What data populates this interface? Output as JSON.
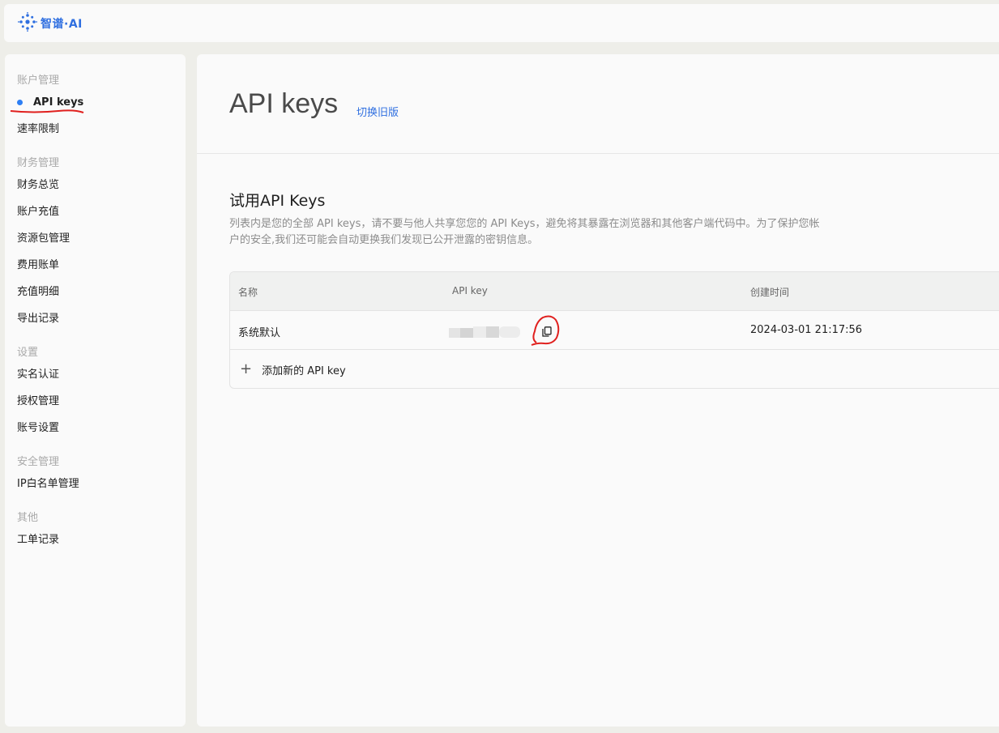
{
  "brand": {
    "name": "智谱·AI",
    "icon": "logo-dots-icon",
    "color": "#2f6fe0"
  },
  "sidebar": {
    "groups": [
      {
        "title": "账户管理",
        "items": [
          {
            "label": "API keys",
            "active": true
          },
          {
            "label": "速率限制"
          }
        ]
      },
      {
        "title": "财务管理",
        "items": [
          {
            "label": "财务总览"
          },
          {
            "label": "账户充值"
          },
          {
            "label": "资源包管理"
          },
          {
            "label": "费用账单"
          },
          {
            "label": "充值明细"
          },
          {
            "label": "导出记录"
          }
        ]
      },
      {
        "title": "设置",
        "items": [
          {
            "label": "实名认证"
          },
          {
            "label": "授权管理"
          },
          {
            "label": "账号设置"
          }
        ]
      },
      {
        "title": "安全管理",
        "items": [
          {
            "label": "IP白名单管理"
          }
        ]
      },
      {
        "title": "其他",
        "items": [
          {
            "label": "工单记录"
          }
        ]
      }
    ]
  },
  "main": {
    "title": "API keys",
    "switch_link": "切换旧版",
    "section_title": "试用API Keys",
    "section_desc": "列表内是您的全部 API keys，请不要与他人共享您您的 API Keys，避免将其暴露在浏览器和其他客户端代码中。为了保护您帐户的安全,我们还可能会自动更换我们发现已公开泄露的密钥信息。",
    "table": {
      "headers": {
        "name": "名称",
        "key": "API key",
        "created": "创建时间"
      },
      "rows": [
        {
          "name": "系统默认",
          "key_masked": true,
          "created": "2024-03-01 21:17:56"
        }
      ],
      "add_label": "添加新的 API key"
    }
  },
  "colors": {
    "accent": "#2f6fe0",
    "active_dot": "#2e7ff4",
    "annotation": "#e0201e"
  }
}
